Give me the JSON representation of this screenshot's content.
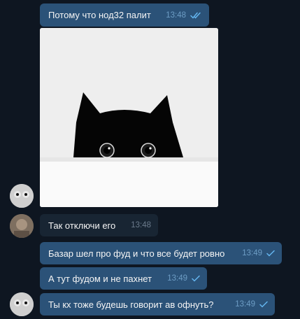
{
  "messages": [
    {
      "text": "Потому что нод32 палит",
      "time": "13:48",
      "status": "read"
    },
    {
      "text": "Так отключи его",
      "time": "13:48"
    },
    {
      "text": "Базар шел про фуд и что все будет ровно",
      "time": "13:49",
      "status": "sent"
    },
    {
      "text": "А тут фудом и не пахнет",
      "time": "13:49",
      "status": "sent"
    },
    {
      "text": "Ты кх тоже будешь говорит ав офнуть?",
      "time": "13:49",
      "status": "sent"
    }
  ],
  "photo": {
    "subject": "black cat peeking over white surface"
  },
  "colors": {
    "background": "#0e1621",
    "outgoing_bubble": "#2b5278",
    "incoming_bubble": "#182533",
    "check_color": "#64b5ef"
  }
}
